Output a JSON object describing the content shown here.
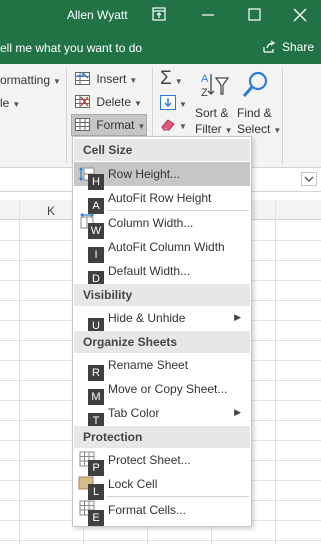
{
  "title_bar": {
    "user": "Allen Wyatt",
    "ribbon_options_icon": "ribbon-display-icon",
    "minimize_icon": "minimize-icon",
    "maximize_icon": "maximize-icon",
    "close_icon": "close-icon"
  },
  "tell_me": {
    "text": "ell me what you want to do",
    "share": "Share"
  },
  "ribbon": {
    "conditional_formatting": "ormatting",
    "table_style_partial": "le",
    "insert": "Insert",
    "delete": "Delete",
    "format": "Format",
    "sort_filter_line1": "Sort &",
    "sort_filter_line2": "Filter",
    "find_select_line1": "Find &",
    "find_select_line2": "Select"
  },
  "grid": {
    "column_k": "K"
  },
  "menu": {
    "sections": {
      "cell_size": "Cell Size",
      "visibility": "Visibility",
      "organize_sheets": "Organize Sheets",
      "protection": "Protection"
    },
    "items": {
      "row_height": {
        "label": "Row Height...",
        "keytip": "H"
      },
      "autofit_row_height": {
        "label": "AutoFit Row Height",
        "keytip": "A"
      },
      "column_width": {
        "label": "Column Width...",
        "keytip": "W"
      },
      "autofit_column_width": {
        "label": "AutoFit Column Width",
        "keytip": "I"
      },
      "default_width": {
        "label": "Default Width...",
        "keytip": "D"
      },
      "hide_unhide": {
        "label": "Hide & Unhide",
        "keytip": "U"
      },
      "rename_sheet": {
        "label": "Rename Sheet",
        "keytip": "R"
      },
      "move_copy_sheet": {
        "label": "Move or Copy Sheet...",
        "keytip": "M"
      },
      "tab_color": {
        "label": "Tab Color",
        "keytip": "T"
      },
      "protect_sheet": {
        "label": "Protect Sheet...",
        "keytip": "P"
      },
      "lock_cell": {
        "label": "Lock Cell",
        "keytip": "L"
      },
      "format_cells": {
        "label": "Format Cells...",
        "keytip": "E"
      }
    }
  },
  "colors": {
    "excel_green": "#217346",
    "ribbon_bg": "#f3f3f3",
    "menu_header_bg": "#e7e7e7",
    "hover_bg": "#c6c6c6",
    "keytip_bg": "#404040"
  }
}
